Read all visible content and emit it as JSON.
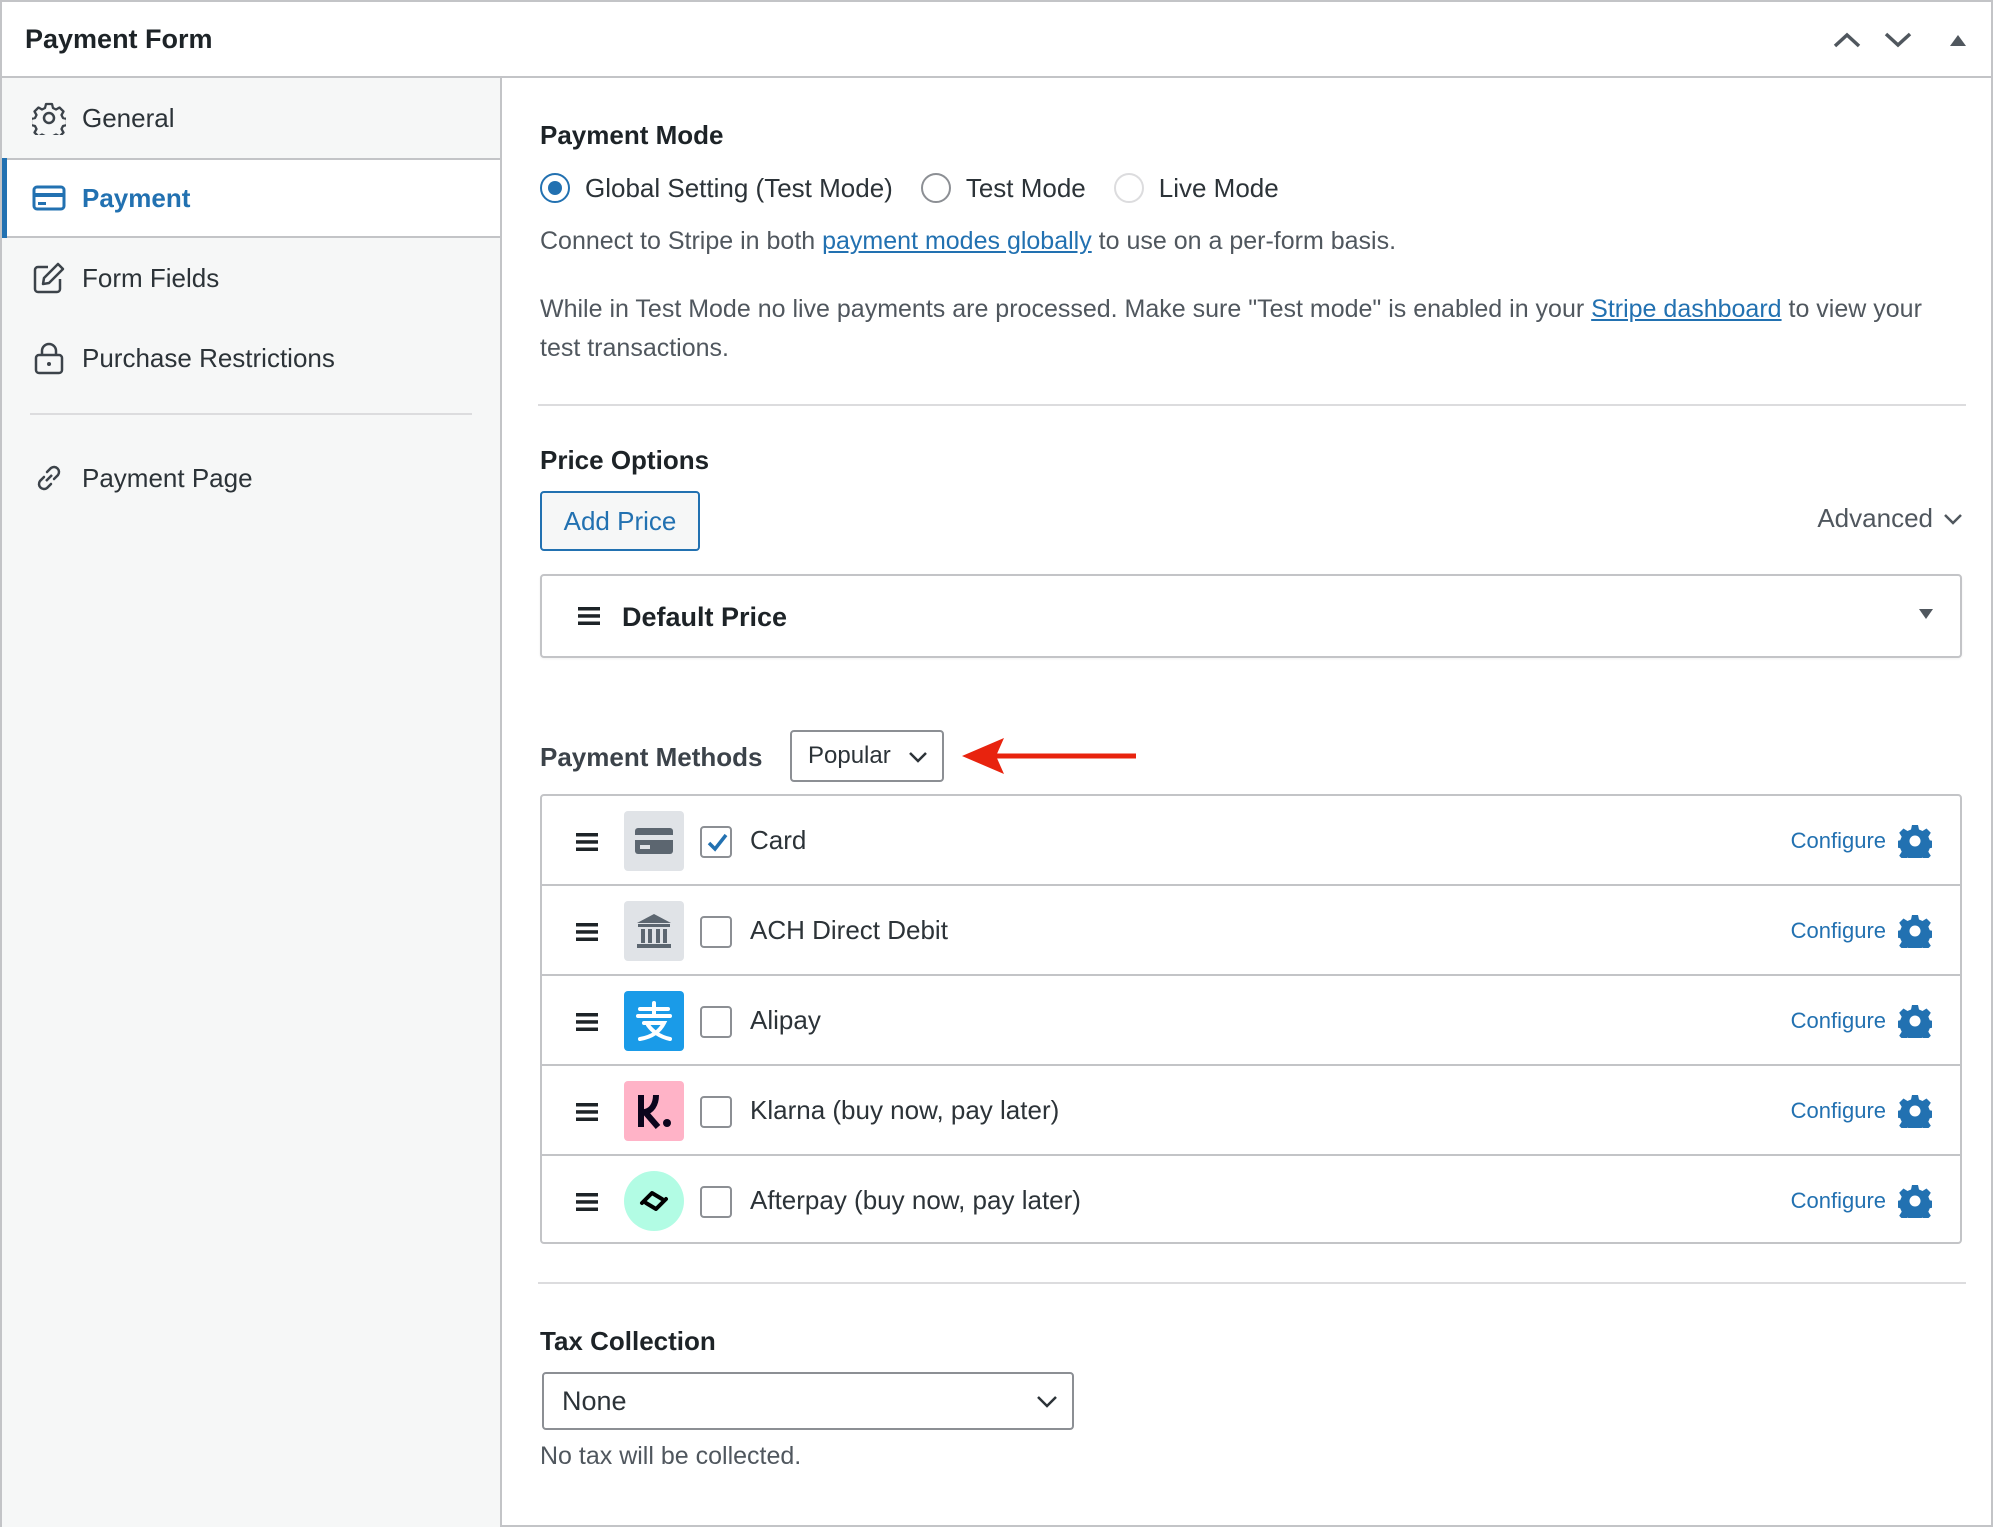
{
  "header": {
    "title": "Payment Form"
  },
  "sidebar": {
    "items": [
      {
        "label": "General",
        "icon": "gear-icon"
      },
      {
        "label": "Payment",
        "icon": "credit-card-icon",
        "active": true
      },
      {
        "label": "Form Fields",
        "icon": "edit-icon"
      },
      {
        "label": "Purchase Restrictions",
        "icon": "lock-icon"
      },
      {
        "label": "Payment Page",
        "icon": "link-icon"
      }
    ]
  },
  "payment_mode": {
    "title": "Payment Mode",
    "options": [
      {
        "label": "Global Setting (Test Mode)",
        "selected": true
      },
      {
        "label": "Test Mode",
        "selected": false
      },
      {
        "label": "Live Mode",
        "selected": false,
        "disabled": true
      }
    ],
    "connect_prefix": "Connect to Stripe in both",
    "connect_link": "payment modes globally",
    "connect_suffix": "to use on a per-form basis.",
    "testmode_prefix": "While in Test Mode no live payments are processed. Make sure \"Test mode\" is enabled in your",
    "testmode_link": "Stripe dashboard",
    "testmode_suffix": "to view your test transactions."
  },
  "price_options": {
    "title": "Price Options",
    "add_button": "Add Price",
    "advanced_label": "Advanced",
    "default_price": "Default Price"
  },
  "payment_methods": {
    "title": "Payment Methods",
    "filter_value": "Popular",
    "configure_label": "Configure",
    "items": [
      {
        "label": "Card",
        "checked": true,
        "icon": "credit-card-icon"
      },
      {
        "label": "ACH Direct Debit",
        "checked": false,
        "icon": "bank-icon"
      },
      {
        "label": "Alipay",
        "checked": false,
        "icon": "alipay-icon"
      },
      {
        "label": "Klarna (buy now, pay later)",
        "checked": false,
        "icon": "klarna-icon"
      },
      {
        "label": "Afterpay (buy now, pay later)",
        "checked": false,
        "icon": "afterpay-icon"
      }
    ]
  },
  "tax": {
    "title": "Tax Collection",
    "selected": "None",
    "help": "No tax will be collected."
  },
  "colors": {
    "accent": "#2271b1",
    "annotation_arrow": "#e8230e",
    "alipay": "#1a9be8",
    "klarna": "#ffb3c7",
    "afterpay": "#b2fce4"
  }
}
